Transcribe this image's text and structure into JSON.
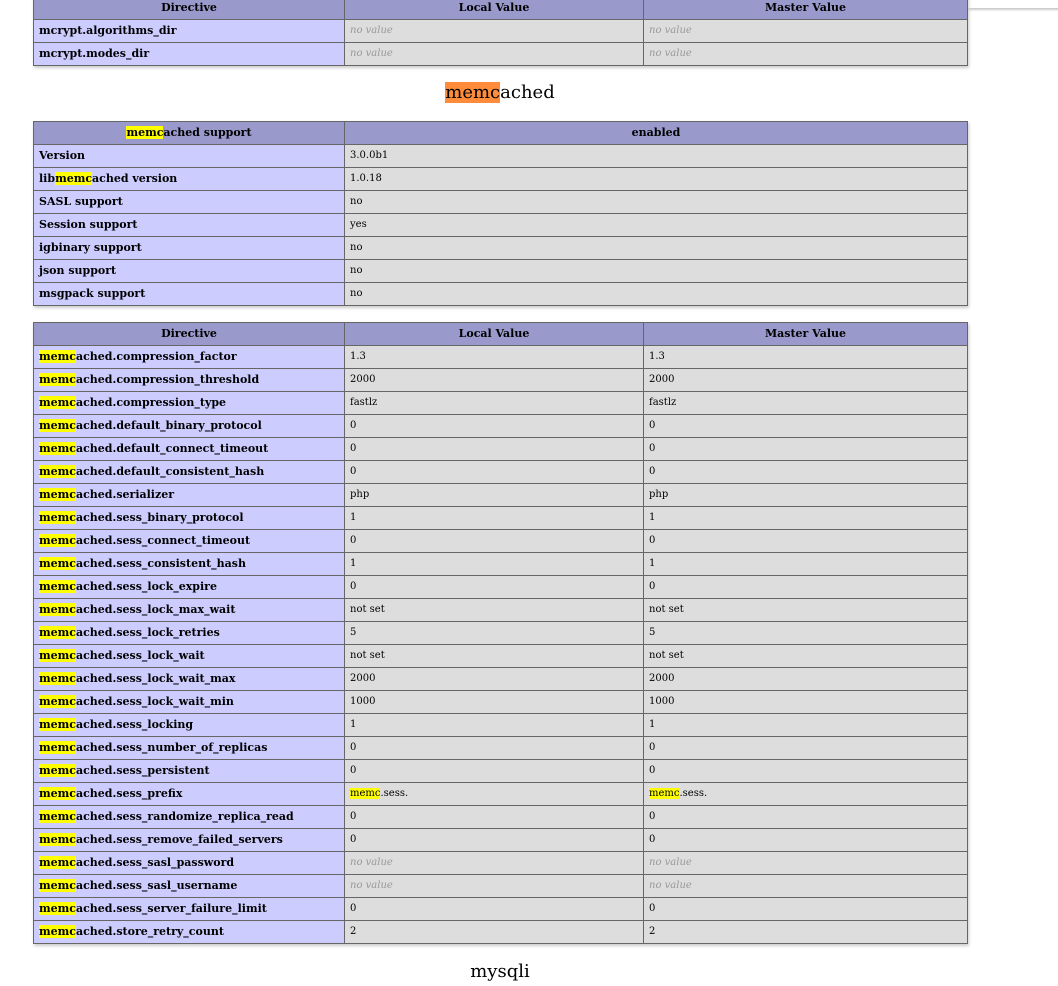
{
  "mcrypt": {
    "headers": [
      "Directive",
      "Local Value",
      "Master Value"
    ],
    "rows": [
      {
        "name": "mcrypt.algorithms_dir",
        "local": "no value",
        "master": "no value"
      },
      {
        "name": "mcrypt.modes_dir",
        "local": "no value",
        "master": "no value"
      }
    ]
  },
  "memcached": {
    "title_highlight": "memc",
    "title_rest": "ached",
    "support": {
      "header_hl": "memc",
      "header_rest": "ached support",
      "header_value": "enabled",
      "rows": [
        {
          "name": "Version",
          "value": "3.0.0b1"
        },
        {
          "name_pre": "lib",
          "name_hl": "memc",
          "name_rest": "ached version",
          "value": "1.0.18"
        },
        {
          "name": "SASL support",
          "value": "no"
        },
        {
          "name": "Session support",
          "value": "yes"
        },
        {
          "name": "igbinary support",
          "value": "no"
        },
        {
          "name": "json support",
          "value": "no"
        },
        {
          "name": "msgpack support",
          "value": "no"
        }
      ]
    },
    "directives": {
      "headers": [
        "Directive",
        "Local Value",
        "Master Value"
      ],
      "prefix_hl": "memc",
      "rows": [
        {
          "rest": "ached.compression_factor",
          "local": "1.3",
          "master": "1.3"
        },
        {
          "rest": "ached.compression_threshold",
          "local": "2000",
          "master": "2000"
        },
        {
          "rest": "ached.compression_type",
          "local": "fastlz",
          "master": "fastlz"
        },
        {
          "rest": "ached.default_binary_protocol",
          "local": "0",
          "master": "0"
        },
        {
          "rest": "ached.default_connect_timeout",
          "local": "0",
          "master": "0"
        },
        {
          "rest": "ached.default_consistent_hash",
          "local": "0",
          "master": "0"
        },
        {
          "rest": "ached.serializer",
          "local": "php",
          "master": "php"
        },
        {
          "rest": "ached.sess_binary_protocol",
          "local": "1",
          "master": "1"
        },
        {
          "rest": "ached.sess_connect_timeout",
          "local": "0",
          "master": "0"
        },
        {
          "rest": "ached.sess_consistent_hash",
          "local": "1",
          "master": "1"
        },
        {
          "rest": "ached.sess_lock_expire",
          "local": "0",
          "master": "0"
        },
        {
          "rest": "ached.sess_lock_max_wait",
          "local": "not set",
          "master": "not set"
        },
        {
          "rest": "ached.sess_lock_retries",
          "local": "5",
          "master": "5"
        },
        {
          "rest": "ached.sess_lock_wait",
          "local": "not set",
          "master": "not set"
        },
        {
          "rest": "ached.sess_lock_wait_max",
          "local": "2000",
          "master": "2000"
        },
        {
          "rest": "ached.sess_lock_wait_min",
          "local": "1000",
          "master": "1000"
        },
        {
          "rest": "ached.sess_locking",
          "local": "1",
          "master": "1"
        },
        {
          "rest": "ached.sess_number_of_replicas",
          "local": "0",
          "master": "0"
        },
        {
          "rest": "ached.sess_persistent",
          "local": "0",
          "master": "0"
        },
        {
          "rest": "ached.sess_prefix",
          "local_hl": "memc",
          "local": ".sess.",
          "master_hl": "memc",
          "master": ".sess."
        },
        {
          "rest": "ached.sess_randomize_replica_read",
          "local": "0",
          "master": "0"
        },
        {
          "rest": "ached.sess_remove_failed_servers",
          "local": "0",
          "master": "0"
        },
        {
          "rest": "ached.sess_sasl_password",
          "local": "no value",
          "master": "no value",
          "novalue": true
        },
        {
          "rest": "ached.sess_sasl_username",
          "local": "no value",
          "master": "no value",
          "novalue": true
        },
        {
          "rest": "ached.sess_server_failure_limit",
          "local": "0",
          "master": "0"
        },
        {
          "rest": "ached.store_retry_count",
          "local": "2",
          "master": "2"
        }
      ]
    }
  },
  "next_section": {
    "title": "mysqli"
  },
  "colors": {
    "header_bg": "#9999cc",
    "name_bg": "#ccccff",
    "value_bg": "#dddddd",
    "highlight": "#ffff00",
    "title_highlight": "#ff8c3a"
  }
}
